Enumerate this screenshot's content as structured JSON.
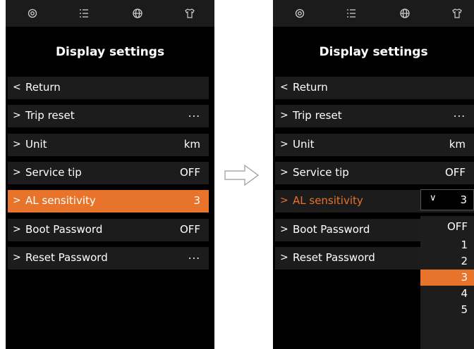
{
  "screens": {
    "title": "Display settings",
    "tabs": [
      "gear-icon",
      "list-icon",
      "globe-icon",
      "shirt-icon"
    ],
    "items": [
      {
        "label": "Return",
        "value": "",
        "chevron": "<"
      },
      {
        "label": "Trip reset",
        "value": "...",
        "chevron": ">"
      },
      {
        "label": "Unit",
        "value": "km",
        "chevron": ">"
      },
      {
        "label": "Service tip",
        "value": "OFF",
        "chevron": ">"
      },
      {
        "label": "AL sensitivity",
        "value": "3",
        "chevron": ">"
      },
      {
        "label": "Boot Password",
        "value": "OFF",
        "chevron": ">"
      },
      {
        "label": "Reset Password",
        "value": "...",
        "chevron": ">"
      }
    ]
  },
  "dropdown": {
    "selected": "3",
    "options": [
      "OFF",
      "1",
      "2",
      "3",
      "4",
      "5"
    ]
  },
  "colors": {
    "accent": "#e8732a",
    "background": "#000000",
    "row": "#1c1c1c",
    "tabbar": "#1b1b1b"
  }
}
